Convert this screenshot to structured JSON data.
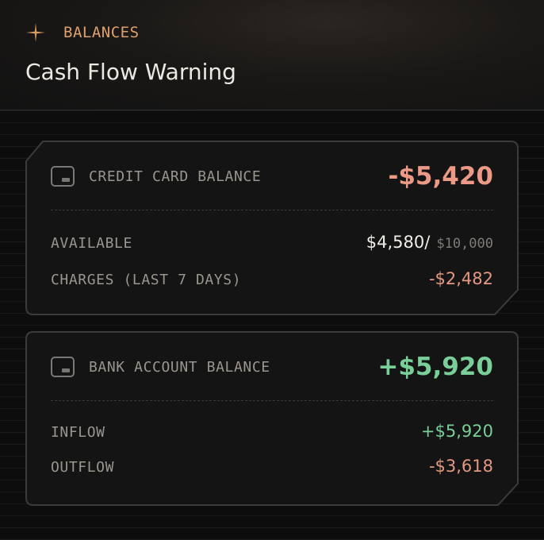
{
  "header": {
    "eyebrow": "BALANCES",
    "title": "Cash Flow Warning",
    "icon": "sparkle-icon",
    "accent": "#e0a06a"
  },
  "credit_card": {
    "icon": "card-icon",
    "label": "CREDIT CARD BALANCE",
    "balance": "-$5,420",
    "available_label": "AVAILABLE",
    "available_value": "$4,580/",
    "credit_limit": "$10,000",
    "charges_label": "CHARGES (LAST 7 DAYS)",
    "charges_value": "-$2,482"
  },
  "bank_account": {
    "icon": "card-icon",
    "label": "BANK ACCOUNT BALANCE",
    "balance": "+$5,920",
    "inflow_label": "INFLOW",
    "inflow_value": "+$5,920",
    "outflow_label": "OUTFLOW",
    "outflow_value": "-$3,618"
  },
  "colors": {
    "negative": "#ec9a86",
    "positive": "#79cf98"
  }
}
